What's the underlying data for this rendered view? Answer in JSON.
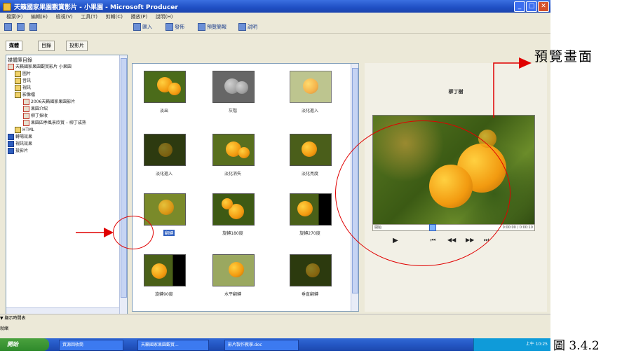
{
  "window": {
    "title": "天籟國家果園觀賞影片 - 小果園 - Microsoft Producer",
    "buttons": [
      "_",
      "□",
      "✕"
    ]
  },
  "menu": [
    "檔案(F)",
    "編輯(E)",
    "檢視(V)",
    "工具(T)",
    "剪輯(C)",
    "播放(P)",
    "說明(H)"
  ],
  "toolbar": [
    {
      "icon": "new-icon",
      "label": ""
    },
    {
      "icon": "open-icon",
      "label": ""
    },
    {
      "icon": "save-icon",
      "label": ""
    },
    {
      "icon": "import-icon",
      "label": "匯入"
    },
    {
      "icon": "publish-icon",
      "label": "發佈"
    },
    {
      "icon": "preview-icon",
      "label": "預覽簡報"
    },
    {
      "icon": "help-icon",
      "label": "說明"
    }
  ],
  "tabs": [
    "媒體",
    "目錄",
    "投影片"
  ],
  "tree": {
    "header": "媒體庫目錄",
    "items": [
      {
        "label": "天籟國家果園觀賞影片 小果園",
        "icon": "folder-red",
        "level": 0
      },
      {
        "label": "圖片",
        "icon": "folder",
        "level": 1
      },
      {
        "label": "音訊",
        "icon": "folder",
        "level": 1
      },
      {
        "label": "視訊",
        "icon": "folder",
        "level": 1
      },
      {
        "label": "影像檔",
        "icon": "folder",
        "level": 1
      },
      {
        "label": "2006天籟國家果園影片",
        "icon": "clip",
        "level": 2
      },
      {
        "label": "果園介紹",
        "icon": "clip",
        "level": 2
      },
      {
        "label": "柳丁採收",
        "icon": "clip",
        "level": 2
      },
      {
        "label": "果園四季風景欣賞 – 柳丁成熟",
        "icon": "clip",
        "level": 2
      },
      {
        "label": "HTML",
        "icon": "folder",
        "level": 1
      },
      {
        "label": "轉場效果",
        "icon": "blue",
        "level": 0
      },
      {
        "label": "視訊效果",
        "icon": "blue",
        "level": 0
      },
      {
        "label": "投影片",
        "icon": "blue",
        "level": 0
      }
    ]
  },
  "effects": [
    {
      "label": "淡出",
      "tone": "color"
    },
    {
      "label": "灰階",
      "tone": "gray"
    },
    {
      "label": "淡化進入",
      "tone": "light"
    },
    {
      "label": "淡化進入",
      "tone": "dark"
    },
    {
      "label": "淡化消失",
      "tone": "color"
    },
    {
      "label": "淡化亮度",
      "tone": "color"
    },
    {
      "label": "翻轉",
      "tone": "color"
    },
    {
      "label": "旋轉180度",
      "tone": "color"
    },
    {
      "label": "旋轉270度",
      "tone": "edge"
    },
    {
      "label": "旋轉90度",
      "tone": "edge"
    },
    {
      "label": "水平翻轉",
      "tone": "light"
    },
    {
      "label": "垂直翻轉",
      "tone": "dark"
    }
  ],
  "preview": {
    "title": "柳丁樹",
    "seek_left": "開始",
    "seek_right": "0:00:00 / 0:00:10",
    "controls": [
      "▶",
      "⏮",
      "◀◀",
      "▶▶",
      "⏭"
    ]
  },
  "statusbar": {
    "text": "▼ 顯示時間表",
    "text2": "就緒"
  },
  "taskbar": {
    "start": "開始",
    "tasks": [
      "資源回收筒",
      "天籟國家果園觀賞...",
      "影片製作教學.doc"
    ],
    "tray": "上午 10:25"
  },
  "annotations": {
    "preview_label": "預覽畫面",
    "figure_caption": "圖 3.4.2"
  },
  "colors": {
    "annotation": "#e00000",
    "title_bar": "#1f4fc4",
    "taskbar": "#2457c4"
  }
}
